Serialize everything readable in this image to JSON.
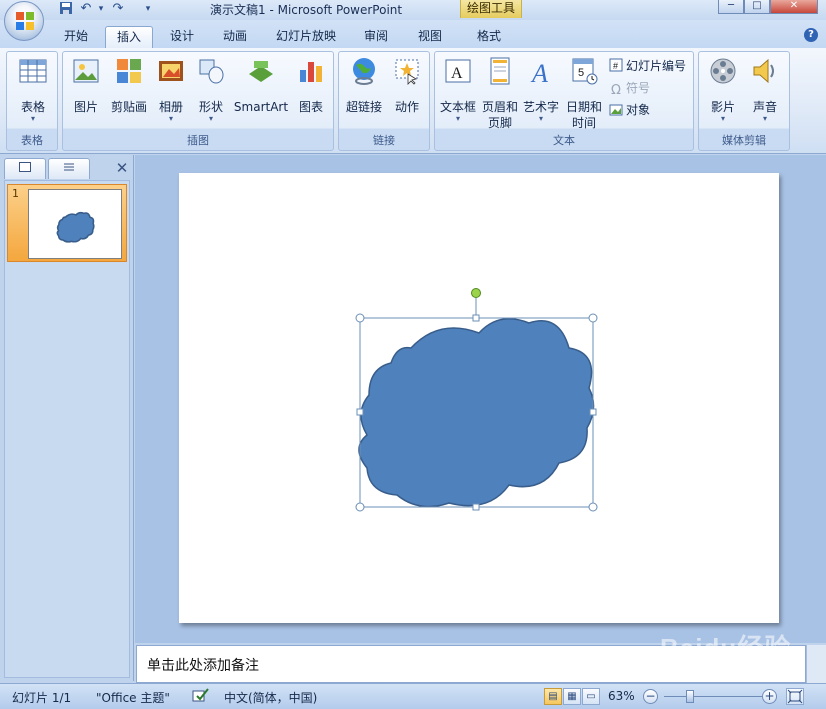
{
  "window": {
    "title": "演示文稿1 - Microsoft PowerPoint",
    "context_tab_group": "绘图工具"
  },
  "tabs": [
    {
      "label": "开始",
      "active": false
    },
    {
      "label": "插入",
      "active": true
    },
    {
      "label": "设计",
      "active": false
    },
    {
      "label": "动画",
      "active": false
    },
    {
      "label": "幻灯片放映",
      "active": false
    },
    {
      "label": "审阅",
      "active": false
    },
    {
      "label": "视图",
      "active": false
    },
    {
      "label": "格式",
      "active": false
    }
  ],
  "ribbon": {
    "groups": {
      "tables": {
        "label": "表格",
        "table": "表格"
      },
      "illustrations": {
        "label": "插图",
        "picture": "图片",
        "clipart": "剪贴画",
        "album": "相册",
        "shapes": "形状",
        "smartart": "SmartArt",
        "chart": "图表"
      },
      "links": {
        "label": "链接",
        "hyperlink": "超链接",
        "action": "动作"
      },
      "text": {
        "label": "文本",
        "textbox": "文本框",
        "header_footer_1": "页眉和",
        "header_footer_2": "页脚",
        "wordart": "艺术字",
        "datetime_1": "日期和",
        "datetime_2": "时间",
        "slide_number": "幻灯片编号",
        "symbol": "符号",
        "object": "对象"
      },
      "media": {
        "label": "媒体剪辑",
        "movie": "影片",
        "sound": "声音"
      }
    }
  },
  "slides_panel": {
    "slide_number": "1"
  },
  "notes": {
    "placeholder": "单击此处添加备注"
  },
  "watermark": "Baidu经验",
  "status": {
    "slide_count": "幻灯片 1/1",
    "theme": "\"Office 主题\"",
    "language": "中文(简体，中国)",
    "zoom": "63%"
  },
  "colors": {
    "cloud_fill": "#4f81bd",
    "cloud_stroke": "#385d8a",
    "handle_rotate": "#9bd44a"
  }
}
